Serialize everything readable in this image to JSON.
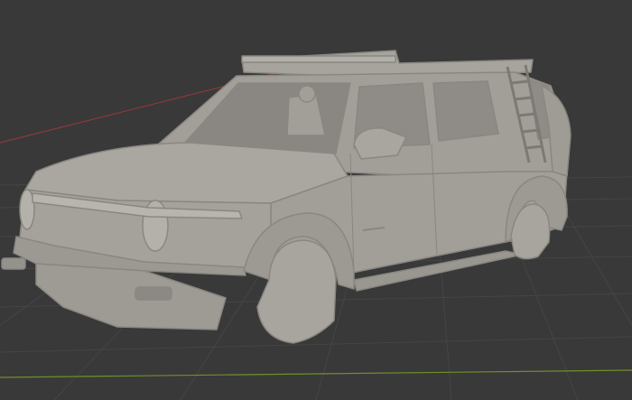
{
  "viewport": {
    "background": "#393939",
    "grid_color": "#454545",
    "axis_x_color": "#8a3a3a",
    "axis_y_color": "#6f8f2a",
    "model_color": "#a29f99",
    "model_shadow_color": "#8a8782",
    "model_highlight_color": "#b8b5af",
    "model_dark_color": "#6c6a66"
  }
}
